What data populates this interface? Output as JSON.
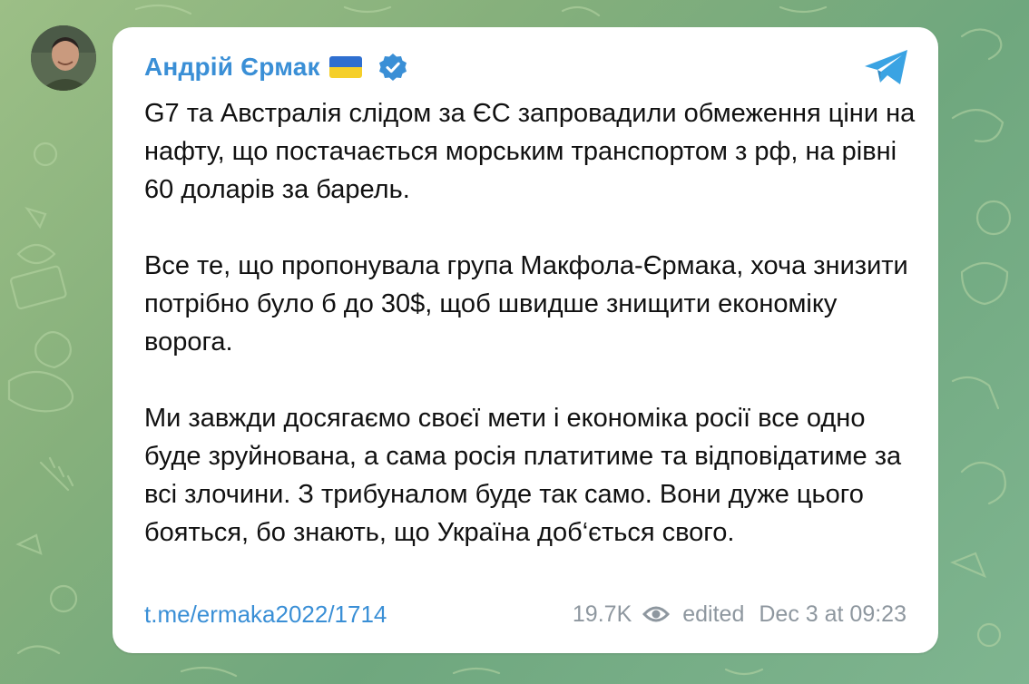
{
  "channel": {
    "name": "Андрій Єрмак",
    "flag_icon": "ukraine-flag-icon",
    "verified_icon": "verified-badge-icon",
    "app_icon": "telegram-icon"
  },
  "message": {
    "paragraphs": [
      "G7 та Австралія слідом за ЄС запровадили обмеження ціни на нафту, що постачається морським транспортом з рф, на рівні 60 доларів за барель.",
      "Все те, що пропонувала група Макфола-Єрмака, хоча знизити потрібно було б до 30$, щоб швидше знищити економіку ворога.",
      "Ми завжди досягаємо своєї мети і економіка росії все одно буде зруйнована, а сама росія платитиме та відповідатиме за всі злочини. З трибуналом буде так само. Вони дуже цього бояться, бо знають, що Україна доб‘ється свого."
    ]
  },
  "footer": {
    "link": "t.me/ermaka2022/1714",
    "views": "19.7K",
    "edited_label": "edited",
    "timestamp": "Dec 3 at 09:23"
  },
  "colors": {
    "accent": "#3a8fd6",
    "meta": "#8e979f",
    "background": "#86b07c",
    "bubble": "#ffffff"
  }
}
